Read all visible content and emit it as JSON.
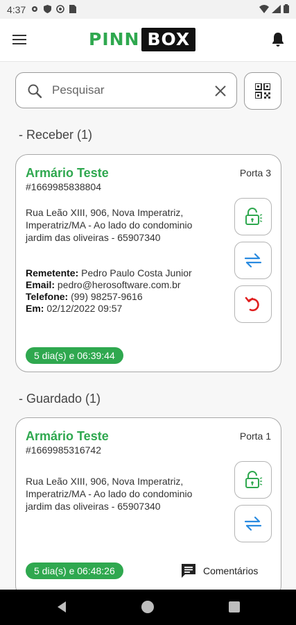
{
  "status_bar": {
    "time": "4:37"
  },
  "app": {
    "logo_left": "PINN",
    "logo_right": "BOX"
  },
  "search": {
    "placeholder": "Pesquisar",
    "value": ""
  },
  "sections": {
    "receive": {
      "title": "- Receber (1)"
    },
    "stored": {
      "title": "- Guardado (1)"
    }
  },
  "cards": [
    {
      "title": "Armário Teste",
      "id": "#1669985838804",
      "door": "Porta 3",
      "address": "Rua Leão XIII, 906, Nova Imperatriz, Imperatriz/MA - Ao lado do condominio jardim das oliveiras - 65907340",
      "sender_label": "Remetente:",
      "sender": "Pedro Paulo Costa Junior",
      "email_label": "Email:",
      "email": "pedro@herosoftware.com.br",
      "phone_label": "Telefone:",
      "phone": "(99) 98257-9616",
      "date_label": "Em:",
      "date": "02/12/2022 09:57",
      "timer": "5 dia(s) e 06:39:44"
    },
    {
      "title": "Armário Teste",
      "id": "#1669985316742",
      "door": "Porta 1",
      "address": "Rua Leão XIII, 906, Nova Imperatriz, Imperatriz/MA - Ao lado do condominio jardim das oliveiras - 65907340",
      "timer": "5 dia(s) e 06:48:26",
      "comments_label": "Comentários"
    }
  ],
  "icons": {
    "menu": "hamburger-icon",
    "notifications": "bell-icon",
    "search": "search-icon",
    "clear": "close-icon",
    "qr": "qr-code-icon",
    "unlock": "unlock-icon",
    "transfer": "swap-arrows-icon",
    "return": "undo-icon",
    "comments": "comment-icon"
  },
  "colors": {
    "brand_green": "#2fa84f",
    "transfer_blue": "#2a8be0",
    "return_red": "#e02020"
  }
}
